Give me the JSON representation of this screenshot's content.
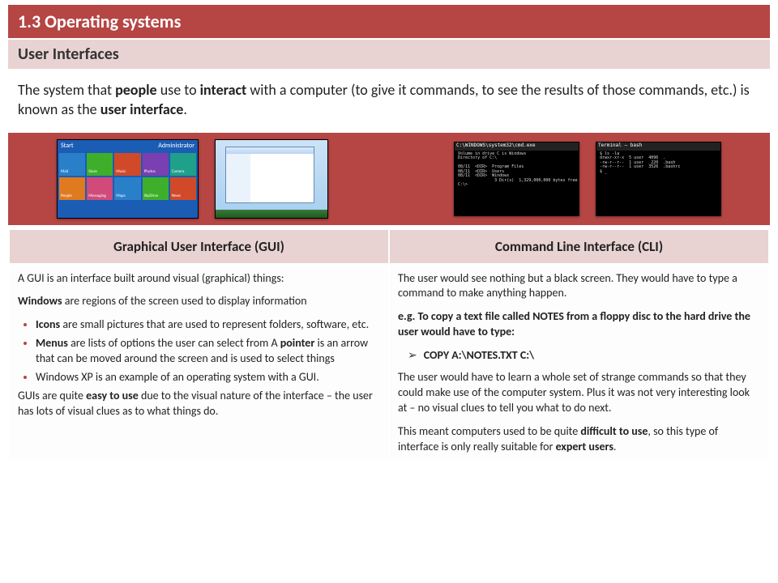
{
  "header": {
    "title": "1.3 Operating systems",
    "subtitle": "User Interfaces"
  },
  "intro": {
    "pre": "The system that ",
    "b1": "people",
    "mid1": " use to ",
    "b2": "interact",
    "mid2": " with a computer (to give it commands, to see the results of those commands, etc.) is known as the ",
    "b3": "user interface",
    "post": "."
  },
  "images": {
    "gui1_start": "Start",
    "gui1_user": "Administrator",
    "tiles": [
      "Mail",
      "Store",
      "Music",
      "Photos",
      "Camera",
      "People",
      "Messaging",
      "Maps",
      "SkyDrive",
      "News"
    ],
    "cli_header1": "C:\\WINDOWS\\system32\\cmd.exe",
    "cli_header2": "Terminal — bash",
    "cli_body1": "Volume in drive C is Windows\nDirectory of C:\\\n\n08/11  <DIR>  Program Files\n08/11  <DIR>  Users\n08/11  <DIR>  Windows\n               3 Dir(s)  1,329,000,000 bytes free\nC:\\>",
    "cli_body2": "$ ls -la\ndrwxr-xr-x  5 user  4096  .\n-rw-r--r--  1 user   220  .bash\n-rw-r--r--  1 user  3526  .bashrc\n$ _"
  },
  "table": {
    "gui_header": "Graphical User Interface (GUI)",
    "cli_header": "Command Line Interface (CLI)",
    "gui": {
      "p1": "A GUI is an interface built around visual (graphical) things:",
      "p2_pre": "",
      "p2_b": "Windows",
      "p2_post": " are regions of the screen used to display information",
      "bullet1_b": "Icons",
      "bullet1_post": " are small pictures that are used to represent folders, software, etc.",
      "bullet2_b": "Menus",
      "bullet2_mid": " are lists of options the user can select from A ",
      "bullet2_b2": "pointer",
      "bullet2_post": " is an arrow that can be moved around the screen and is used to select things",
      "bullet3": "Windows XP is an example of an operating system with a GUI.",
      "p3_pre": "GUIs are quite ",
      "p3_b": "easy to use",
      "p3_post": " due to the visual nature of the interface – the user has lots of visual clues as to what things do."
    },
    "cli": {
      "p1": "The user would see nothing but a black screen. They would have to type a command to make anything happen.",
      "p2": "e.g. To copy a text file called NOTES from a floppy disc to the hard drive the user would have to type:",
      "cmd": "COPY A:\\NOTES.TXT C:\\",
      "p3": "The user would have to learn a whole set of strange commands so that they could make use of the computer system. Plus it was not very interesting look at – no visual clues to tell you what to do next.",
      "p4_pre": "This meant computers used to be quite ",
      "p4_b1": "difficult to use",
      "p4_mid": ", so this type of interface is only really suitable for ",
      "p4_b2": "expert users",
      "p4_post": "."
    }
  }
}
